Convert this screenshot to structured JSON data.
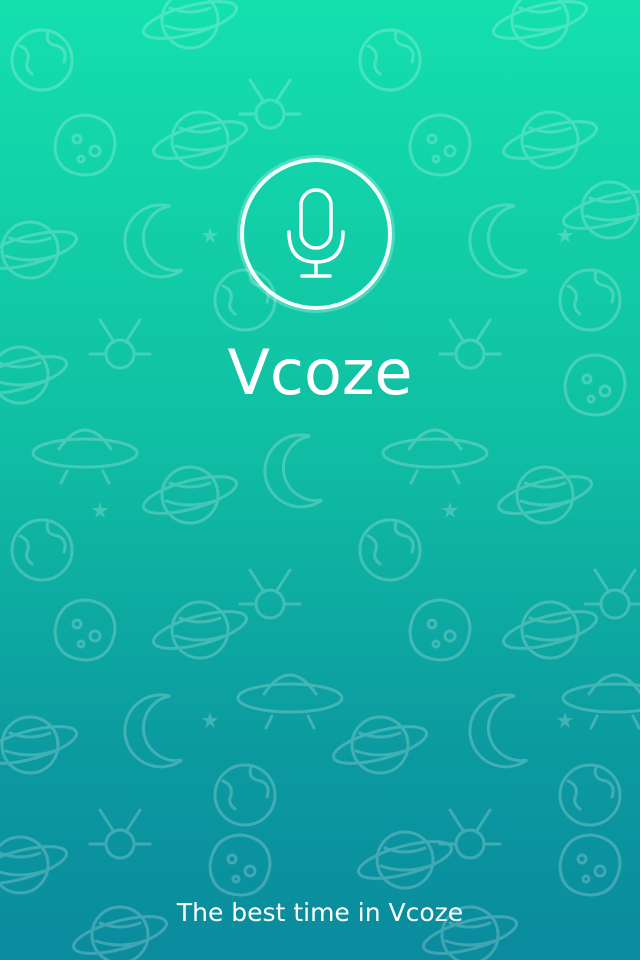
{
  "app": {
    "name": "Vcoze",
    "tagline": "The best time in Vcoze"
  },
  "logo": {
    "icon": "microphone-icon"
  },
  "background": {
    "pattern": "space-doodles",
    "gradient_top": "#14e0ae",
    "gradient_bottom": "#0a8b9e"
  },
  "colors": {
    "text": "#ffffff"
  }
}
